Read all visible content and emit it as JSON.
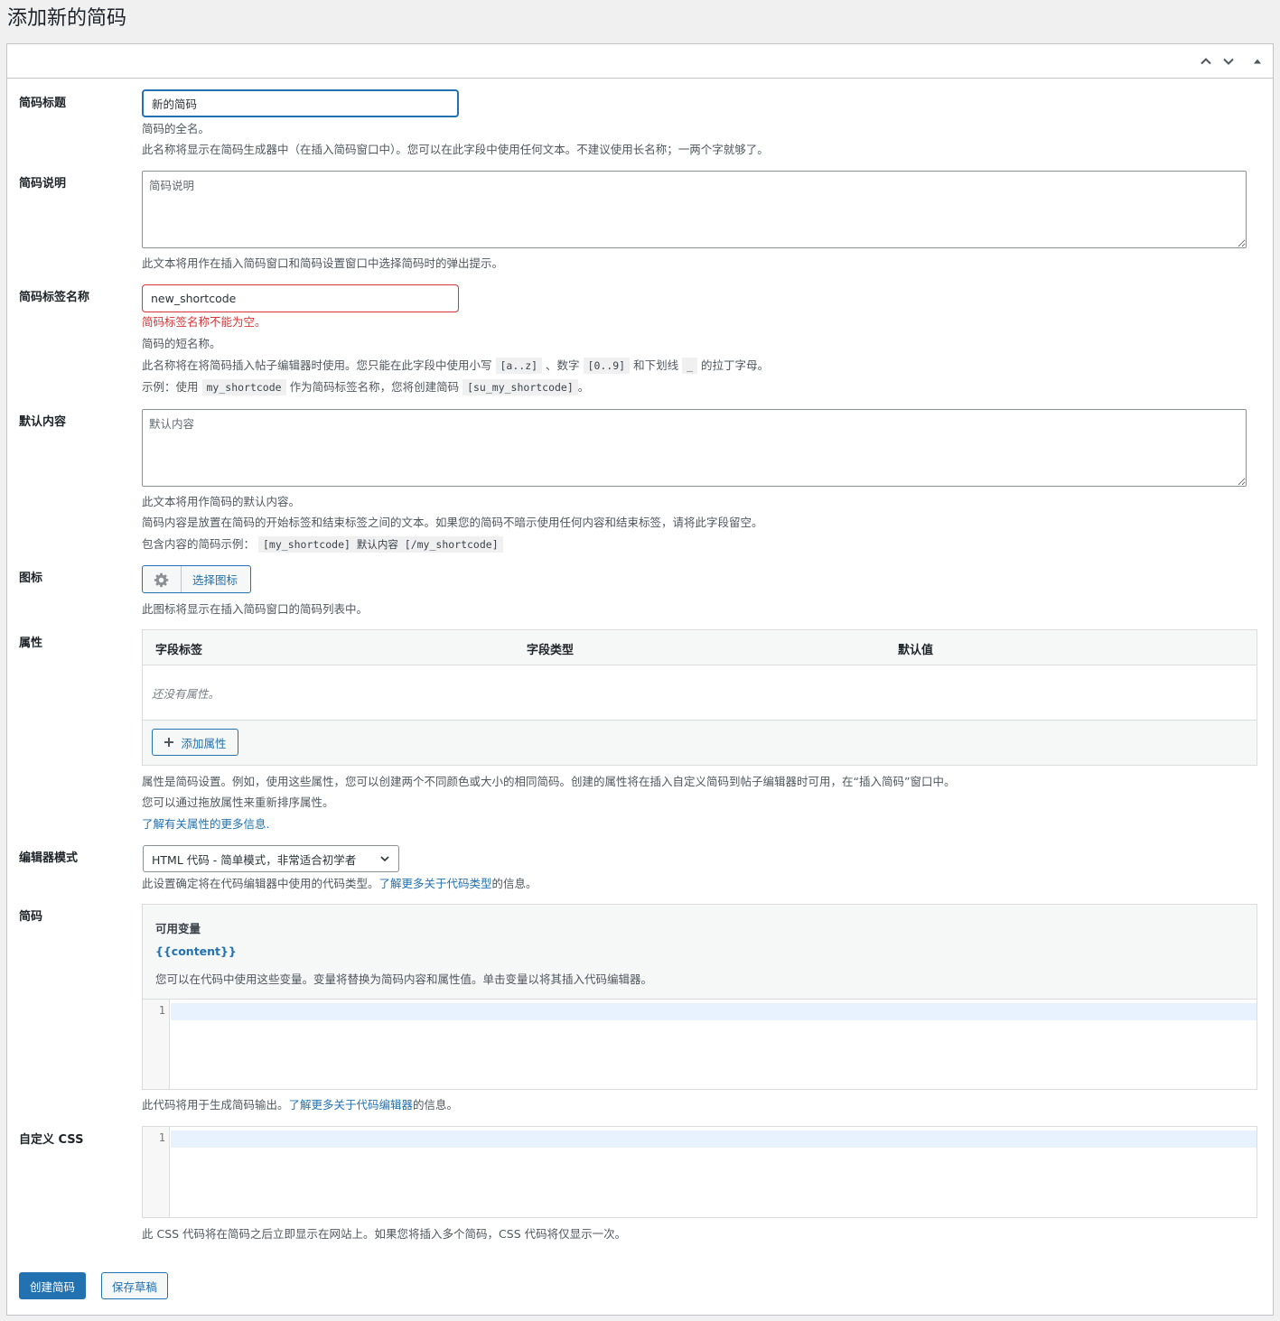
{
  "page": {
    "title": "添加新的简码"
  },
  "header_controls": {
    "move_up": "chevron-up-icon",
    "move_down": "chevron-down-icon",
    "toggle": "triangle-up-icon"
  },
  "fields": {
    "title": {
      "label": "简码标题",
      "value": "新的简码",
      "help1": "简码的全名。",
      "help2": "此名称将显示在简码生成器中（在插入简码窗口中）。您可以在此字段中使用任何文本。不建议使用长名称；一两个字就够了。"
    },
    "description": {
      "label": "简码说明",
      "placeholder": "简码说明",
      "help": "此文本将用作在插入简码窗口和简码设置窗口中选择简码时的弹出提示。"
    },
    "tag": {
      "label": "简码标签名称",
      "value": "new_shortcode",
      "error": "简码标签名称不能为空。",
      "help1": "简码的短名称。",
      "help2_a": "此名称将在将简码插入帖子编辑器时使用。您只能在此字段中使用小写",
      "code_az": "[a..z]",
      "help2_b": "、数字",
      "code_09": "[0..9]",
      "help2_c": "和下划线",
      "code_us": "_",
      "help2_d": "的拉丁字母。",
      "help3_a": "示例：使用",
      "code_my": "my_shortcode",
      "help3_b": "作为简码标签名称，您将创建简码",
      "code_su": "[su_my_shortcode]",
      "help3_c": "。"
    },
    "content": {
      "label": "默认内容",
      "placeholder": "默认内容",
      "help1": "此文本将用作简码的默认内容。",
      "help2": "简码内容是放置在简码的开始标签和结束标签之间的文本。如果您的简码不暗示使用任何内容和结束标签，请将此字段留空。",
      "help3_a": "包含内容的简码示例：",
      "code_example": "[my_shortcode] 默认内容 [/my_shortcode]"
    },
    "icon": {
      "label": "图标",
      "button": "选择图标",
      "help": "此图标将显示在插入简码窗口的简码列表中。"
    },
    "attributes": {
      "label": "属性",
      "columns": [
        "字段标签",
        "字段类型",
        "默认值"
      ],
      "empty": "还没有属性。",
      "add_button": "添加属性",
      "help1": "属性是简码设置。例如，使用这些属性，您可以创建两个不同颜色或大小的相同简码。创建的属性将在插入自定义简码到帖子编辑器时可用，在“插入简码”窗口中。",
      "help2": "您可以通过拖放属性来重新排序属性。",
      "help_link": "了解有关属性的更多信息."
    },
    "editor_mode": {
      "label": "编辑器模式",
      "selected": "HTML 代码 - 简单模式，非常适合初学者",
      "help_a": "此设置确定将在代码编辑器中使用的代码类型。",
      "help_link": "了解更多关于代码类型",
      "help_b": "的信息。"
    },
    "code": {
      "label": "简码",
      "vars_title": "可用变量",
      "var_content": "{{content}}",
      "vars_help": "您可以在代码中使用这些变量。变量将替换为简码内容和属性值。单击变量以将其插入代码编辑器。",
      "line_number": "1",
      "help_a": "此代码将用于生成简码输出。",
      "help_link": "了解更多关于代码编辑器",
      "help_b": "的信息。"
    },
    "css": {
      "label": "自定义 CSS",
      "line_number": "1",
      "help": "此 CSS 代码将在简码之后立即显示在网站上。如果您将插入多个简码，CSS 代码将仅显示一次。"
    }
  },
  "actions": {
    "create": "创建简码",
    "save_draft": "保存草稿"
  },
  "colors": {
    "accent": "#2271b1",
    "error": "#d63638",
    "background": "#f0f0f1"
  }
}
